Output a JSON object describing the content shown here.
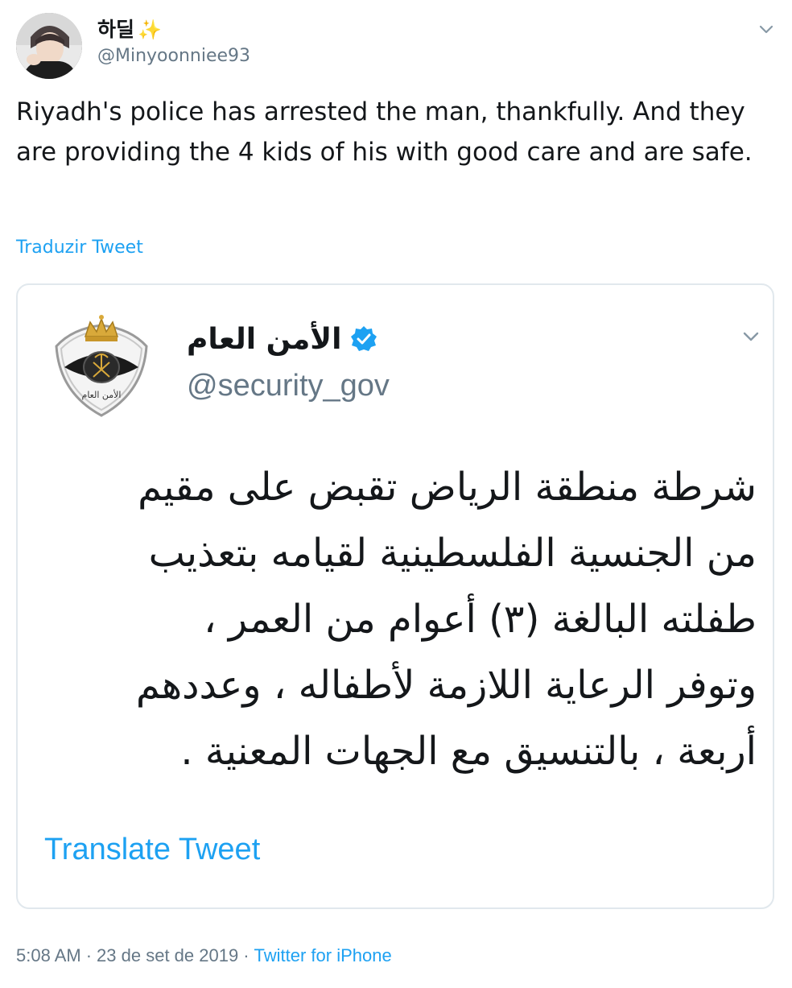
{
  "author": {
    "display_name": "하딜",
    "handle": "@Minyoonniee93",
    "avatar_icon": "user-avatar-photo",
    "emoji_icon": "sparkles-icon"
  },
  "tweet": {
    "text": "Riyadh's police has arrested the man, thankfully. And they are providing the 4 kids of his with good care and are safe.",
    "translate_label": "Traduzir Tweet"
  },
  "quoted": {
    "display_name": "الأمن العام",
    "handle": "@security_gov",
    "logo_icon": "public-security-emblem",
    "verified_icon": "verified-badge-icon",
    "text_lines": [
      "شرطة منطقة الرياض تقبض على مقيم",
      "من الجنسية الفلسطينية لقيامه بتعذيب",
      "طفلته البالغة (٣) أعوام من العمر ،",
      "وتوفر الرعاية اللازمة لأطفاله ، وعددهم",
      "أربعة ، بالتنسيق مع الجهات المعنية ."
    ],
    "translate_label": "Translate Tweet"
  },
  "meta": {
    "time": "5:08 AM",
    "date": "23 de set de 2019",
    "separator": "·",
    "source": "Twitter for iPhone"
  },
  "colors": {
    "link": "#1da1f2",
    "secondary_text": "#657786",
    "border": "#e1e8ed",
    "verified": "#1da1f2"
  }
}
